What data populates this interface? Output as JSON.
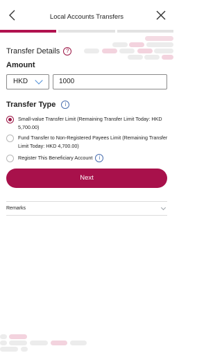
{
  "header": {
    "title": "Local Accounts Transfers",
    "back_icon": "chevron-left-icon",
    "close_icon": "close-icon"
  },
  "progress": {
    "steps": 3,
    "current_step": 1,
    "accent": "#b1124f"
  },
  "transfer_details": {
    "title": "Transfer Details",
    "help_icon": "?"
  },
  "amount": {
    "label": "Amount",
    "currency": "HKD",
    "value": "1000"
  },
  "transfer_type": {
    "label": "Transfer Type",
    "info_icon": "i",
    "options": [
      {
        "label": "Small-value Transfer Limit (Remaining Transfer Limit Today: HKD 5,700.00)",
        "selected": true
      },
      {
        "label": "Fund Transfer to Non-Registered Payees Limit (Remaining Transfer Limit Today: HKD 4,700.00)",
        "selected": false
      }
    ],
    "register_beneficiary": {
      "label": "Register This Beneficiary Account",
      "checked": false,
      "info_icon": "i"
    }
  },
  "next_button": {
    "label": "Next",
    "color": "#a8114b"
  },
  "remarks": {
    "label": "Remarks"
  }
}
